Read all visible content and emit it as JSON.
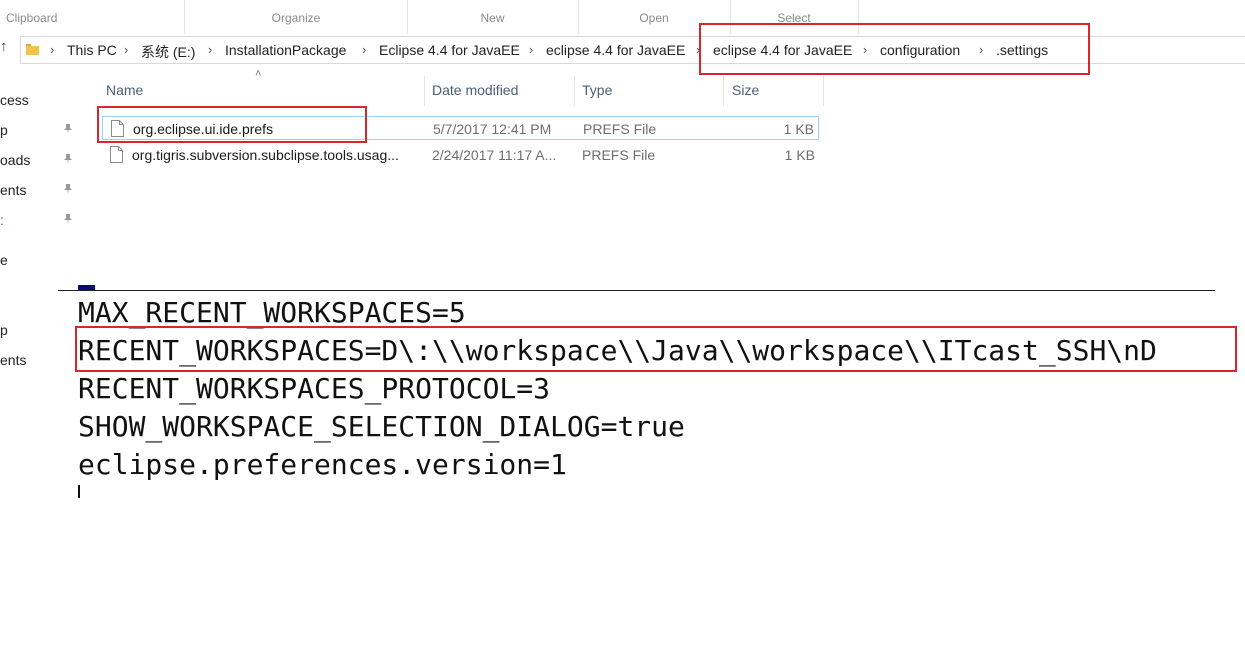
{
  "ribbon": {
    "groups": [
      "Clipboard",
      "Organize",
      "New",
      "Open",
      "Select"
    ]
  },
  "address_bar": {
    "crumbs": [
      "This PC",
      "系统 (E:)",
      "InstallationPackage",
      "Eclipse 4.4 for JavaEE",
      "eclipse 4.4 for JavaEE",
      "eclipse 4.4 for JavaEE",
      "configuration",
      ".settings"
    ],
    "separator_icon": "chevron-right-icon",
    "up_icon": "up-arrow-icon"
  },
  "nav": {
    "items": [
      "cess",
      "p",
      "oads",
      "ents",
      ":",
      "e",
      "p",
      "ents"
    ]
  },
  "file_list": {
    "columns": {
      "name": "Name",
      "date": "Date modified",
      "type": "Type",
      "size": "Size"
    },
    "rows": [
      {
        "name": "org.eclipse.ui.ide.prefs",
        "date": "5/7/2017 12:41 PM",
        "type": "PREFS File",
        "size": "1 KB"
      },
      {
        "name": "org.tigris.subversion.subclipse.tools.usag...",
        "date": "2/24/2017 11:17 A...",
        "type": "PREFS File",
        "size": "1 KB"
      }
    ]
  },
  "editor": {
    "lines": [
      "MAX_RECENT_WORKSPACES=5",
      "RECENT_WORKSPACES=D\\:\\\\workspace\\\\Java\\\\workspace\\\\ITcast_SSH\\nD",
      "RECENT_WORKSPACES_PROTOCOL=3",
      "SHOW_WORKSPACE_SELECTION_DIALOG=true",
      "eclipse.preferences.version=1"
    ]
  },
  "colors": {
    "highlight": "#d9262c",
    "selection_border": "#99d1ff",
    "header_text": "#4a607a"
  }
}
